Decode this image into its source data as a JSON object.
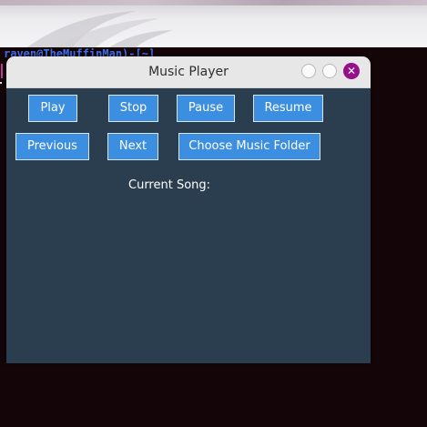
{
  "terminal": {
    "prompt_text": "raven@TheMuffinMan)-[~]"
  },
  "window": {
    "title": "Music Player",
    "controls": {
      "close_glyph": "✕"
    }
  },
  "buttons": {
    "play": "Play",
    "stop": "Stop",
    "pause": "Pause",
    "resume": "Resume",
    "previous": "Previous",
    "next": "Next",
    "choose_folder": "Choose Music Folder"
  },
  "status": {
    "current_song_label": "Current Song:"
  },
  "colors": {
    "window_bg": "#2b3e50",
    "button_bg": "#3c8fe0",
    "close_button": "#96108a",
    "titlebar": "#e7e7e7"
  }
}
